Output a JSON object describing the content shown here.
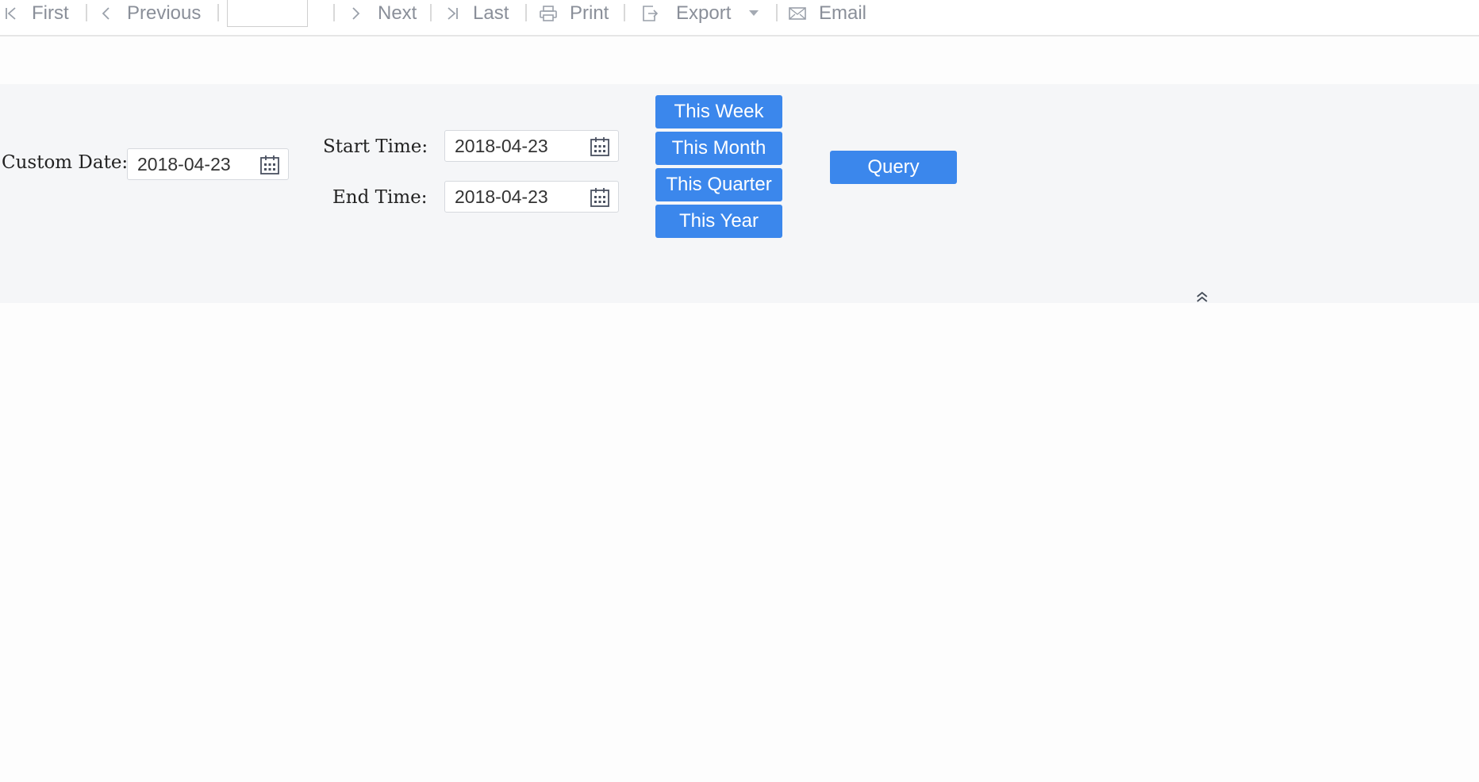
{
  "toolbar": {
    "first_label": "First",
    "previous_label": "Previous",
    "page_value": "",
    "next_label": "Next",
    "last_label": "Last",
    "print_label": "Print",
    "export_label": "Export",
    "email_label": "Email",
    "icons": [
      "first-page-icon",
      "previous-chevron-icon",
      "next-chevron-icon",
      "last-page-icon",
      "printer-icon",
      "export-icon",
      "dropdown-caret-icon",
      "envelope-icon"
    ]
  },
  "query_panel": {
    "custom_date_label": "Custom Date:",
    "custom_date_value": "2018-04-23",
    "start_time_label": "Start Time:",
    "start_time_value": "2018-04-23",
    "end_time_label": "End Time:",
    "end_time_value": "2018-04-23",
    "quick_buttons": [
      "This Week",
      "This Month",
      "This Quarter",
      "This Year"
    ],
    "query_label": "Query",
    "icons": [
      "calendar-icon",
      "collapse-up-icon"
    ]
  },
  "colors": {
    "accent": "#3b87ec",
    "toolbar_text": "#8a8f99",
    "panel_bg": "#f5f6f8"
  }
}
